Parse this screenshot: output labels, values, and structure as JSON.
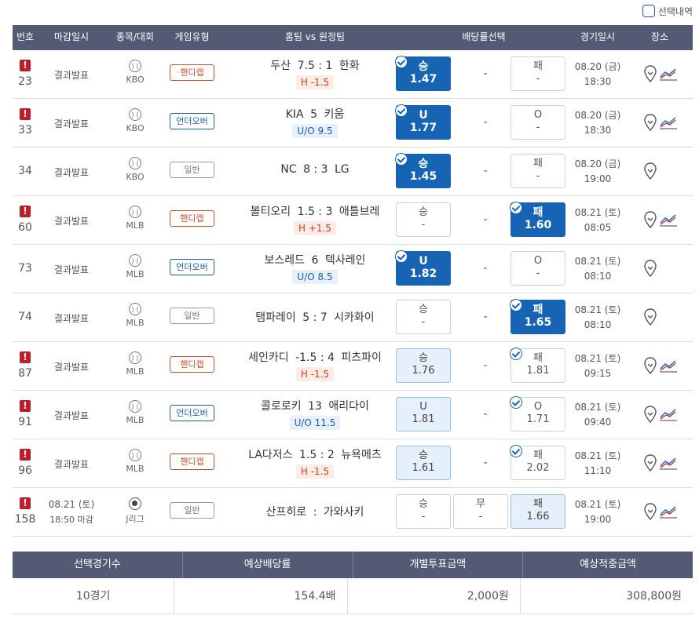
{
  "topbar": {
    "select_label": "선택내역"
  },
  "columns": {
    "no": "번호",
    "deadline": "마감일시",
    "sport": "종목/대회",
    "type": "게임유형",
    "teams": "홈팀 vs 원정팀",
    "odds": "배당률선택",
    "date": "경기일시",
    "place": "장소"
  },
  "rows": [
    {
      "alert": true,
      "no": "23",
      "deadline": "결과발표",
      "sport": "baseball",
      "league": "KBO",
      "type": "핸디캡",
      "type_kind": "handicap",
      "home": "두산",
      "score": "7.5 : 1",
      "away": "한화",
      "sub": "H -1.5",
      "sub_kind": "h",
      "opt1": {
        "label": "승",
        "value": "1.47",
        "state": "sel"
      },
      "opt2": {
        "label": "",
        "value": "-",
        "state": "dash"
      },
      "opt3": {
        "label": "패",
        "value": "-",
        "state": "none"
      },
      "date": "08.20 (금)",
      "time": "18:30",
      "stats": true
    },
    {
      "alert": true,
      "no": "33",
      "deadline": "결과발표",
      "sport": "baseball",
      "league": "KBO",
      "type": "언더오버",
      "type_kind": "ou",
      "home": "KIA",
      "score": "5",
      "away": "키움",
      "sub": "U/O 9.5",
      "sub_kind": "ou",
      "opt1": {
        "label": "U",
        "value": "1.77",
        "state": "sel"
      },
      "opt2": {
        "label": "",
        "value": "-",
        "state": "dash"
      },
      "opt3": {
        "label": "O",
        "value": "-",
        "state": "none"
      },
      "date": "08.20 (금)",
      "time": "18:30",
      "stats": true
    },
    {
      "alert": false,
      "no": "34",
      "deadline": "결과발표",
      "sport": "baseball",
      "league": "KBO",
      "type": "일반",
      "type_kind": "normal",
      "home": "NC",
      "score": "8 : 3",
      "away": "LG",
      "sub": "",
      "sub_kind": "",
      "opt1": {
        "label": "승",
        "value": "1.45",
        "state": "sel"
      },
      "opt2": {
        "label": "",
        "value": "-",
        "state": "dash"
      },
      "opt3": {
        "label": "패",
        "value": "-",
        "state": "none"
      },
      "date": "08.20 (금)",
      "time": "19:00",
      "stats": false
    },
    {
      "alert": true,
      "no": "60",
      "deadline": "결과발표",
      "sport": "baseball",
      "league": "MLB",
      "type": "핸디캡",
      "type_kind": "handicap",
      "home": "볼티오리",
      "score": "1.5 : 3",
      "away": "애틀브레",
      "sub": "H +1.5",
      "sub_kind": "h",
      "opt1": {
        "label": "승",
        "value": "-",
        "state": "none"
      },
      "opt2": {
        "label": "",
        "value": "-",
        "state": "dash"
      },
      "opt3": {
        "label": "패",
        "value": "1.60",
        "state": "sel"
      },
      "date": "08.21 (토)",
      "time": "08:05",
      "stats": true
    },
    {
      "alert": false,
      "no": "73",
      "deadline": "결과발표",
      "sport": "baseball",
      "league": "MLB",
      "type": "언더오버",
      "type_kind": "ou",
      "home": "보스레드",
      "score": "6",
      "away": "텍사레인",
      "sub": "U/O 8.5",
      "sub_kind": "ou",
      "opt1": {
        "label": "U",
        "value": "1.82",
        "state": "sel"
      },
      "opt2": {
        "label": "",
        "value": "-",
        "state": "dash"
      },
      "opt3": {
        "label": "O",
        "value": "-",
        "state": "none"
      },
      "date": "08.21 (토)",
      "time": "08:10",
      "stats": false
    },
    {
      "alert": false,
      "no": "74",
      "deadline": "결과발표",
      "sport": "baseball",
      "league": "MLB",
      "type": "일반",
      "type_kind": "normal",
      "home": "탬파레이",
      "score": "5 : 7",
      "away": "시카화이",
      "sub": "",
      "sub_kind": "",
      "opt1": {
        "label": "승",
        "value": "-",
        "state": "none"
      },
      "opt2": {
        "label": "",
        "value": "-",
        "state": "dash"
      },
      "opt3": {
        "label": "패",
        "value": "1.65",
        "state": "sel"
      },
      "date": "08.21 (토)",
      "time": "08:10",
      "stats": false
    },
    {
      "alert": true,
      "no": "87",
      "deadline": "결과발표",
      "sport": "baseball",
      "league": "MLB",
      "type": "핸디캡",
      "type_kind": "handicap",
      "home": "세인카디",
      "score": "-1.5 : 4",
      "away": "피츠파이",
      "sub": "H -1.5",
      "sub_kind": "h",
      "opt1": {
        "label": "승",
        "value": "1.76",
        "state": "light"
      },
      "opt2": {
        "label": "",
        "value": "-",
        "state": "dash"
      },
      "opt3": {
        "label": "패",
        "value": "1.81",
        "state": "chk"
      },
      "date": "08.21 (토)",
      "time": "09:15",
      "stats": true
    },
    {
      "alert": true,
      "no": "91",
      "deadline": "결과발표",
      "sport": "baseball",
      "league": "MLB",
      "type": "언더오버",
      "type_kind": "ou",
      "home": "콜로로키",
      "score": "13",
      "away": "애리다이",
      "sub": "U/O 11.5",
      "sub_kind": "ou",
      "opt1": {
        "label": "U",
        "value": "1.81",
        "state": "light"
      },
      "opt2": {
        "label": "",
        "value": "-",
        "state": "dash"
      },
      "opt3": {
        "label": "O",
        "value": "1.71",
        "state": "chk"
      },
      "date": "08.21 (토)",
      "time": "09:40",
      "stats": true
    },
    {
      "alert": true,
      "no": "96",
      "deadline": "결과발표",
      "sport": "baseball",
      "league": "MLB",
      "type": "핸디캡",
      "type_kind": "handicap",
      "home": "LA다저스",
      "score": "1.5 : 2",
      "away": "뉴욕메츠",
      "sub": "H -1.5",
      "sub_kind": "h",
      "opt1": {
        "label": "승",
        "value": "1.61",
        "state": "light"
      },
      "opt2": {
        "label": "",
        "value": "-",
        "state": "dash"
      },
      "opt3": {
        "label": "패",
        "value": "2.02",
        "state": "chk"
      },
      "date": "08.21 (토)",
      "time": "11:10",
      "stats": true
    },
    {
      "alert": true,
      "no": "158",
      "deadline": "08.21 (토)",
      "deadline2": "18:50 마감",
      "sport": "soccer",
      "league": "J리그",
      "type": "일반",
      "type_kind": "normal",
      "home": "산프히로",
      "score": ":",
      "away": "가와사키",
      "sub": "",
      "sub_kind": "",
      "opt1": {
        "label": "승",
        "value": "-",
        "state": "none"
      },
      "opt2": {
        "label": "무",
        "value": "-",
        "state": "none"
      },
      "opt3": {
        "label": "패",
        "value": "1.66",
        "state": "light"
      },
      "date": "08.21 (토)",
      "time": "19:00",
      "stats": true
    }
  ],
  "summary": {
    "headers": [
      "선택경기수",
      "예상배당률",
      "개별투표금액",
      "예상적중금액"
    ],
    "values": [
      "10경기",
      "154.4배",
      "2,000원",
      "308,800원"
    ]
  },
  "colors": {
    "header_bg": "#525b73",
    "selected": "#1764b5",
    "light": "#e5f0fb",
    "handicap": "#c6522e",
    "ou": "#1a5fb4",
    "alert": "#c01c28"
  },
  "icons": {
    "place": "map-pin-icon",
    "stats": "chart-icon",
    "alert": "exclamation-icon"
  }
}
